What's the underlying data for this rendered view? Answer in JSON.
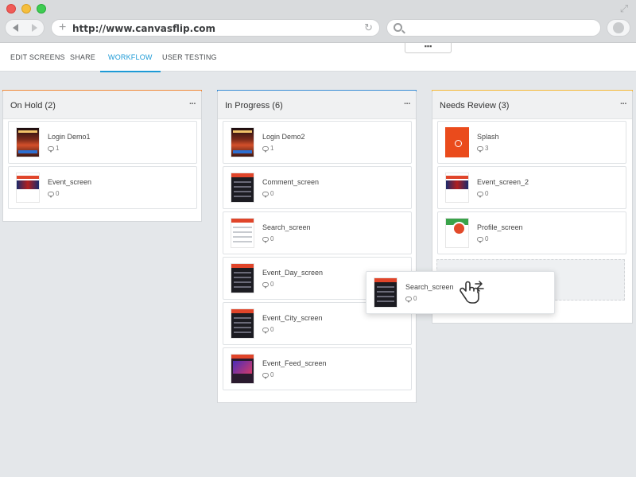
{
  "browser": {
    "url": "http://www.canvasflip.com"
  },
  "tabs": [
    "EDIT SCREENS",
    "SHARE",
    "WORKFLOW",
    "USER TESTING"
  ],
  "active_tab": "WORKFLOW",
  "handle_label": "▪▪▪",
  "column_menu_label": "···",
  "colors": {
    "accent_on_hold": "#f08a3c",
    "accent_in_progress": "#3a8ed6",
    "accent_needs_review": "#f5b93a",
    "active_tab": "#1d9ad6"
  },
  "columns": [
    {
      "title": "On Hold (2)",
      "cards": [
        {
          "name": "Login Demo1",
          "comments": "1",
          "thumb": "poster"
        },
        {
          "name": "Event_screen",
          "comments": "0",
          "thumb": "event"
        }
      ]
    },
    {
      "title": "In Progress (6)",
      "cards": [
        {
          "name": "Login Demo2",
          "comments": "1",
          "thumb": "poster"
        },
        {
          "name": "Comment_screen",
          "comments": "0",
          "thumb": "list"
        },
        {
          "name": "Search_screen",
          "comments": "0",
          "thumb": "white"
        },
        {
          "name": "Event_Day_screen",
          "comments": "0",
          "thumb": "list"
        },
        {
          "name": "Event_City_screen",
          "comments": "0",
          "thumb": "list"
        },
        {
          "name": "Event_Feed_screen",
          "comments": "0",
          "thumb": "feed"
        }
      ]
    },
    {
      "title": "Needs Review (3)",
      "cards": [
        {
          "name": "Splash",
          "comments": "3",
          "thumb": "splash"
        },
        {
          "name": "Event_screen_2",
          "comments": "0",
          "thumb": "event"
        },
        {
          "name": "Profile_screen",
          "comments": "0",
          "thumb": "profile"
        }
      ]
    }
  ],
  "dragging_card": {
    "name": "Search_screen",
    "comments": "0",
    "thumb": "list"
  },
  "icons": {
    "back": "arrow-left-icon",
    "forward": "arrow-right-icon",
    "new_tab": "plus-icon",
    "reload": "reload-icon",
    "search": "search-icon",
    "fullscreen": "expand-icon",
    "comment": "comment-bubble-icon",
    "drag": "drag-hand-icon"
  }
}
